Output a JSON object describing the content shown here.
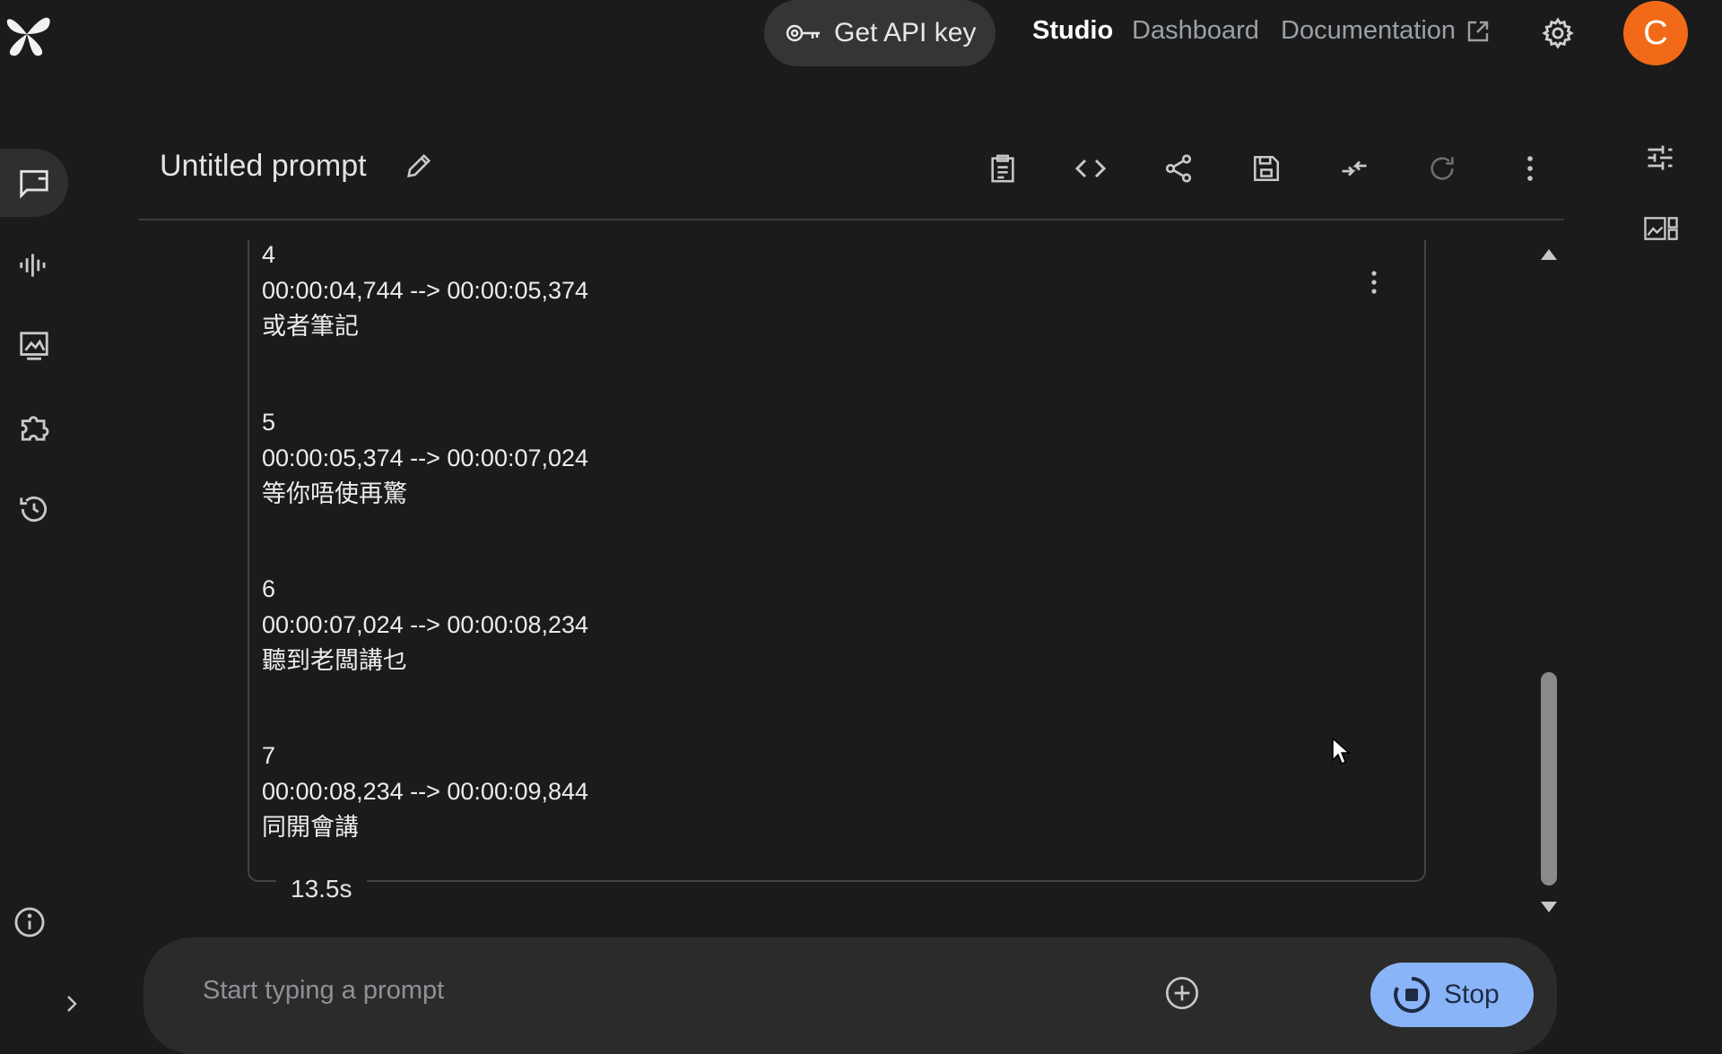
{
  "topbar": {
    "api_key_label": "Get API key",
    "nav": {
      "studio": "Studio",
      "dashboard": "Dashboard",
      "documentation": "Documentation"
    },
    "avatar_initial": "C"
  },
  "header": {
    "title": "Untitled prompt"
  },
  "response": {
    "entries": [
      {
        "index": "4",
        "timecode": "00:00:04,744 --> 00:00:05,374",
        "text": "或者筆記"
      },
      {
        "index": "5",
        "timecode": "00:00:05,374 --> 00:00:07,024",
        "text": "等你唔使再驚"
      },
      {
        "index": "6",
        "timecode": "00:00:07,024 --> 00:00:08,234",
        "text": "聽到老闆講乜"
      },
      {
        "index": "7",
        "timecode": "00:00:08,234 --> 00:00:09,844",
        "text": "同開會講"
      }
    ],
    "elapsed": "13.5s"
  },
  "prompt": {
    "placeholder": "Start typing a prompt",
    "stop_label": "Stop"
  },
  "colors": {
    "accent": "#8ab4f8",
    "avatar": "#f26a18",
    "background": "#1b1b1b"
  },
  "icons": [
    "logo-icon",
    "key-icon",
    "external-link-icon",
    "gear-icon",
    "chat-icon",
    "audio-icon",
    "image-icon",
    "puzzle-icon",
    "history-icon",
    "edit-icon",
    "clipboard-icon",
    "code-icon",
    "share-icon",
    "save-icon",
    "compare-icon",
    "refresh-icon",
    "more-icon",
    "tune-icon",
    "layout-icon",
    "info-icon",
    "chevron-right-icon",
    "add-circle-icon",
    "stop-icon"
  ]
}
